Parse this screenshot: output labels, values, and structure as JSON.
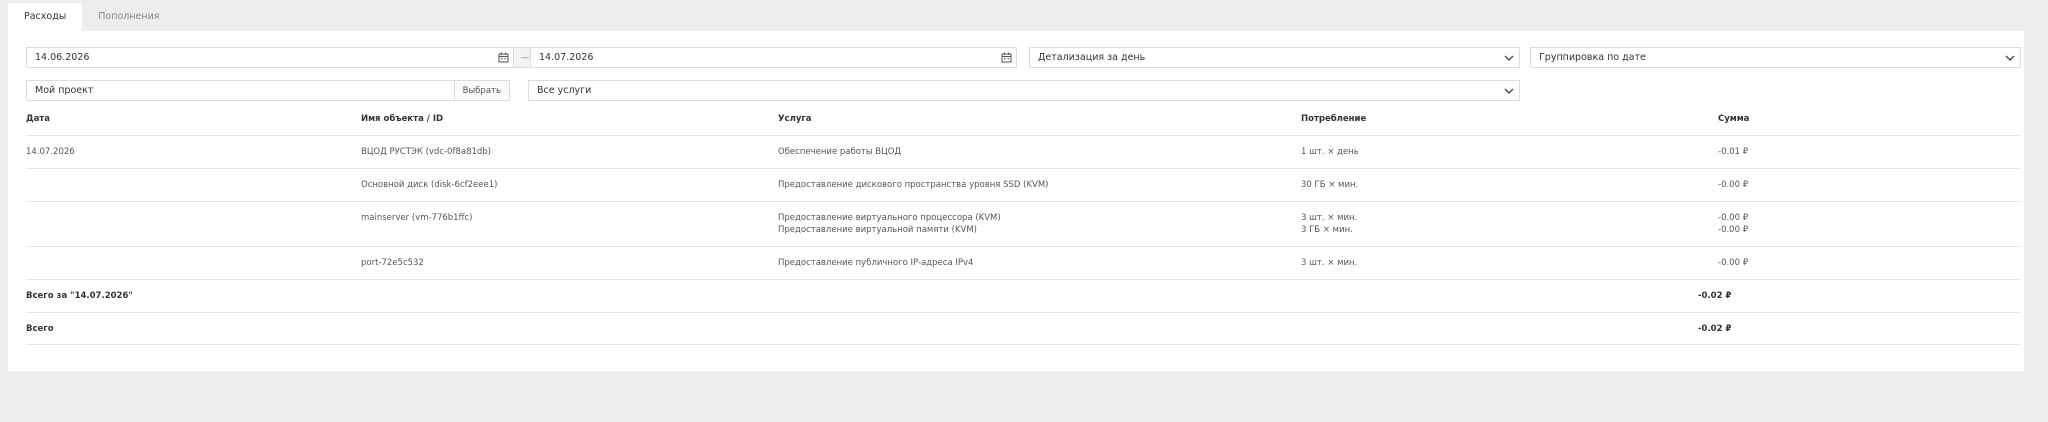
{
  "tabs": [
    {
      "label": "Расходы",
      "active": true
    },
    {
      "label": "Пополнения",
      "active": false
    }
  ],
  "filters": {
    "date_from": "14.06.2026",
    "date_to": "14.07.2026",
    "range_separator": "—",
    "detail": "Детализация за день",
    "grouping": "Группировка по дате",
    "project": "Мой проект",
    "project_button": "Выбрать",
    "services": "Все услуги"
  },
  "table": {
    "headers": {
      "date": "Дата",
      "object": "Имя объекта / ID",
      "service": "Услуга",
      "consumption": "Потребление",
      "sum": "Сумма"
    },
    "rows": [
      {
        "date": "14.07.2026",
        "object": "ВЦОД РУСТЭК (vdc-0f8a81db)",
        "services": [
          "Обеспечение работы ВЦОД"
        ],
        "consumption": [
          "1 шт. × день"
        ],
        "sums": [
          "-0.01 ₽"
        ]
      },
      {
        "date": "",
        "object": "Основной диск (disk-6cf2eee1)",
        "services": [
          "Предоставление дискового пространства уровня SSD (KVM)"
        ],
        "consumption": [
          "30 ГБ × мин."
        ],
        "sums": [
          "-0.00 ₽"
        ]
      },
      {
        "date": "",
        "object": "mainserver (vm-776b1ffc)",
        "services": [
          "Предоставление виртуального процессора (KVM)",
          "Предоставление виртуальной памяти (KVM)"
        ],
        "consumption": [
          "3 шт. × мин.",
          "3 ГБ × мин."
        ],
        "sums": [
          "-0.00 ₽",
          "-0.00 ₽"
        ]
      },
      {
        "date": "",
        "object": "port-72e5c532",
        "services": [
          "Предоставление публичного IP-адреса IPv4"
        ],
        "consumption": [
          "3 шт. × мин."
        ],
        "sums": [
          "-0.00 ₽"
        ]
      }
    ],
    "subtotal": {
      "label": "Всего за \"14.07.2026\"",
      "value": "-0.02 ₽"
    },
    "total": {
      "label": "Всего",
      "value": "-0.02 ₽"
    }
  },
  "icons": {
    "date_from": "calendar-icon",
    "date_to": "calendar-icon",
    "detail_dropdown": "chevron-down-icon",
    "grouping_dropdown": "chevron-down-icon",
    "services_dropdown": "chevron-down-icon"
  },
  "colors": {
    "background": "#ededed",
    "panel": "#ffffff",
    "border": "#dcdcdc",
    "text": "#333333",
    "muted": "#888888"
  }
}
